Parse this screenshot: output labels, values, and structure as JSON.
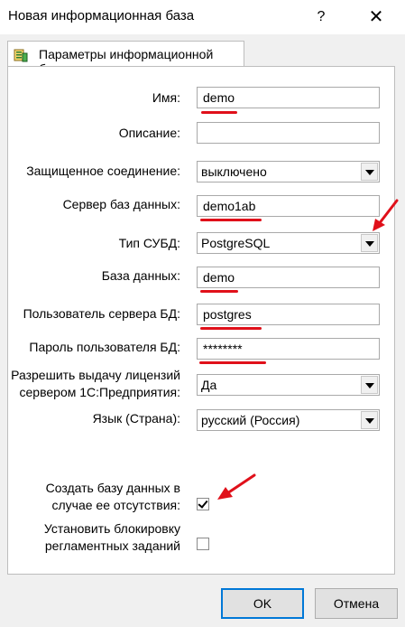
{
  "window": {
    "title": "Новая информационная база",
    "help_label": "?",
    "close_label": "✕"
  },
  "tab": {
    "label": "Параметры информационной базы",
    "icon": "database-icon"
  },
  "form": {
    "name": {
      "label": "Имя:",
      "value": "demo"
    },
    "description": {
      "label": "Описание:",
      "value": ""
    },
    "secure_connection": {
      "label": "Защищенное соединение:",
      "value": "выключено"
    },
    "db_server": {
      "label": "Сервер баз данных:",
      "value": "demo1ab"
    },
    "dbms_type": {
      "label": "Тип СУБД:",
      "value": "PostgreSQL"
    },
    "database": {
      "label": "База данных:",
      "value": "demo"
    },
    "db_user": {
      "label": "Пользователь сервера БД:",
      "value": "postgres"
    },
    "db_password": {
      "label": "Пароль пользователя БД:",
      "value": "********"
    },
    "license": {
      "label_line1": "Разрешить выдачу лицензий",
      "label_line2": "сервером 1С:Предприятия:",
      "value": "Да"
    },
    "language": {
      "label": "Язык (Страна):",
      "value": "русский (Россия)"
    },
    "create_db": {
      "label_line1": "Создать базу данных в",
      "label_line2": "случае ее отсутствия:",
      "checked": true
    },
    "lock_tasks": {
      "label_line1": "Установить блокировку",
      "label_line2": "регламентных заданий",
      "checked": false
    }
  },
  "buttons": {
    "ok": "OK",
    "cancel": "Отмена"
  },
  "annotation_color": "#e0101a"
}
